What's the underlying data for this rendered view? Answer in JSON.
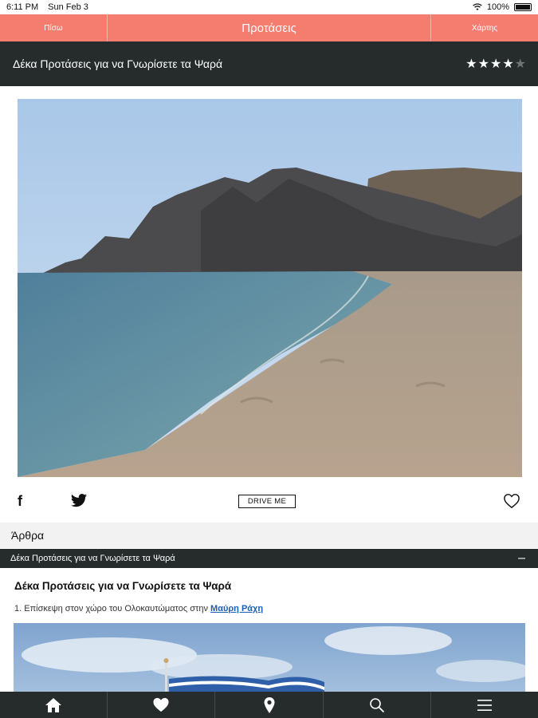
{
  "status_bar": {
    "time": "6:11 PM",
    "date": "Sun Feb 3",
    "battery": "100%"
  },
  "nav": {
    "back_label": "Πίσω",
    "title": "Προτάσεις",
    "map_label": "Χάρτης"
  },
  "header": {
    "title": "Δέκα Προτάσεις για να Γνωρίσετε τα Ψαρά",
    "rating": 4,
    "rating_max": 5
  },
  "share": {
    "facebook_glyph": "f",
    "drive_label": "DRIVE ME"
  },
  "articles": {
    "section_label": "Άρθρα",
    "accordion_title": "Δέκα Προτάσεις για να Γνωρίσετε τα Ψαρά",
    "accordion_toggle": "–",
    "article_title": "Δέκα Προτάσεις για να Γνωρίσετε τα Ψαρά",
    "line_prefix": "1. Επίσκεψη στον χώρο του Ολοκαυτώματος στην ",
    "line_link": "Μαύρη Ράχη"
  },
  "tabs": [
    {
      "icon": "home-icon"
    },
    {
      "icon": "heart-icon"
    },
    {
      "icon": "map-pin-icon"
    },
    {
      "icon": "search-icon"
    },
    {
      "icon": "menu-icon"
    }
  ],
  "colors": {
    "accent": "#f57d6f",
    "dark": "#262b2c",
    "link": "#1a5fb4"
  }
}
